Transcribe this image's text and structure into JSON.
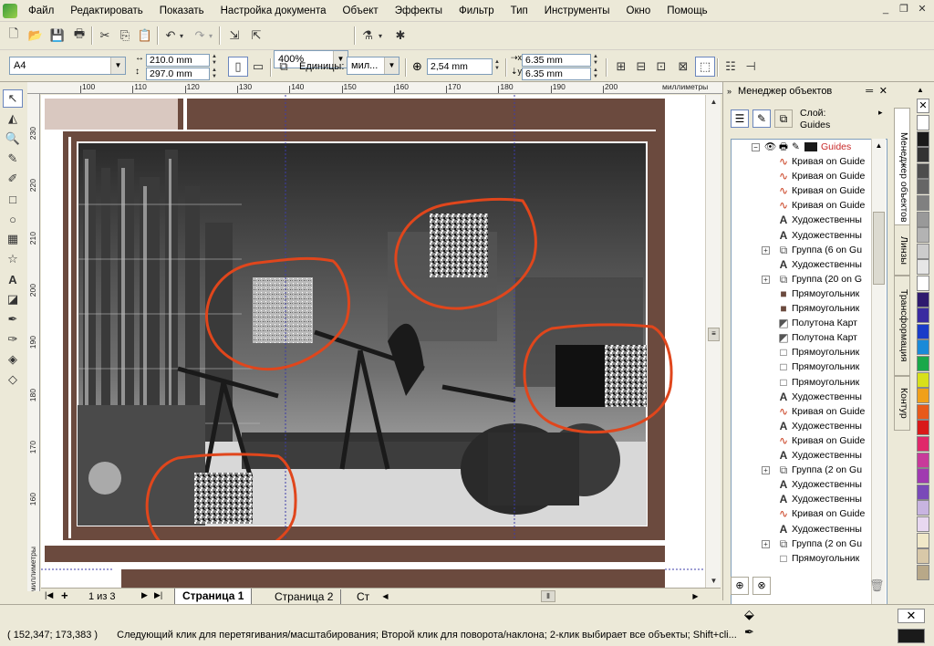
{
  "menubar": {
    "items": [
      "Файл",
      "Редактировать",
      "Показать",
      "Настройка документа",
      "Объект",
      "Эффекты",
      "Фильтр",
      "Тип",
      "Инструменты",
      "Окно",
      "Помощь"
    ]
  },
  "toolbar": {
    "zoom_value": "400%"
  },
  "propbar": {
    "page_size": "A4",
    "width": "210.0 mm",
    "height": "297.0 mm",
    "units_label": "Единицы:",
    "units_value": "мил...",
    "nudge": "2,54 mm",
    "dup_x": "6.35 mm",
    "dup_y": "6.35 mm"
  },
  "rulers": {
    "h_ticks": [
      "100",
      "110",
      "120",
      "130",
      "140",
      "150",
      "160",
      "170",
      "180",
      "190",
      "200"
    ],
    "h_unit": "миллиметры",
    "v_ticks": [
      "230",
      "220",
      "210",
      "200",
      "190",
      "180",
      "170",
      "160"
    ],
    "v_unit": "миллиметры"
  },
  "pages": {
    "counter": "1 из 3",
    "tabs": [
      "Страница 1",
      "Страница 2",
      "Ст"
    ]
  },
  "docker": {
    "title": "Менеджер объектов",
    "layer_label": "Слой:",
    "layer_name": "Guides",
    "root_layer": "Guides",
    "objects": [
      {
        "icon": "curve-icon",
        "label": "Кривая on Guide",
        "expandable": false
      },
      {
        "icon": "curve-icon",
        "label": "Кривая on Guide",
        "expandable": false
      },
      {
        "icon": "curve-icon",
        "label": "Кривая on Guide",
        "expandable": false
      },
      {
        "icon": "curve-icon",
        "label": "Кривая on Guide",
        "expandable": false
      },
      {
        "icon": "artistic-text-icon",
        "label": "Художественны",
        "expandable": false
      },
      {
        "icon": "artistic-text-icon",
        "label": "Художественны",
        "expandable": false
      },
      {
        "icon": "group-icon",
        "label": "Группа (6 on Gu",
        "expandable": true
      },
      {
        "icon": "artistic-text-icon",
        "label": "Художественны",
        "expandable": false
      },
      {
        "icon": "group-icon",
        "label": "Группа (20 on G",
        "expandable": true
      },
      {
        "icon": "rectangle-filled-icon",
        "label": "Прямоугольник",
        "expandable": false
      },
      {
        "icon": "rectangle-filled-icon",
        "label": "Прямоугольник",
        "expandable": false
      },
      {
        "icon": "halftone-icon",
        "label": "Полутона Карт",
        "expandable": false
      },
      {
        "icon": "halftone-icon",
        "label": "Полутона Карт",
        "expandable": false
      },
      {
        "icon": "rectangle-icon",
        "label": "Прямоугольник",
        "expandable": false
      },
      {
        "icon": "rectangle-icon",
        "label": "Прямоугольник",
        "expandable": false
      },
      {
        "icon": "rectangle-icon",
        "label": "Прямоугольник",
        "expandable": false
      },
      {
        "icon": "artistic-text-icon",
        "label": "Художественны",
        "expandable": false
      },
      {
        "icon": "curve-icon",
        "label": "Кривая on Guide",
        "expandable": false
      },
      {
        "icon": "artistic-text-icon",
        "label": "Художественны",
        "expandable": false
      },
      {
        "icon": "curve-icon",
        "label": "Кривая on Guide",
        "expandable": false
      },
      {
        "icon": "artistic-text-icon",
        "label": "Художественны",
        "expandable": false
      },
      {
        "icon": "group-icon",
        "label": "Группа (2 on Gu",
        "expandable": true
      },
      {
        "icon": "artistic-text-icon",
        "label": "Художественны",
        "expandable": false
      },
      {
        "icon": "artistic-text-icon",
        "label": "Художественны",
        "expandable": false
      },
      {
        "icon": "curve-icon",
        "label": "Кривая on Guide",
        "expandable": false
      },
      {
        "icon": "artistic-text-icon",
        "label": "Художественны",
        "expandable": false
      },
      {
        "icon": "group-icon",
        "label": "Группа (2 on Gu",
        "expandable": true
      },
      {
        "icon": "rectangle-icon",
        "label": "Прямоугольник",
        "expandable": false
      }
    ]
  },
  "vtabs": [
    "Менеджер объектов",
    "Линзы",
    "Трансформация",
    "Контур"
  ],
  "palette": [
    "#ffffff",
    "#1a1a1a",
    "#333333",
    "#4d4d4d",
    "#666666",
    "#808080",
    "#999999",
    "#b3b3b3",
    "#cccccc",
    "#e6e6e6",
    "#ffffff",
    "#2e1a6e",
    "#3a2ba0",
    "#1a3cc8",
    "#1a8ad8",
    "#1aa84a",
    "#d8e01a",
    "#f0a01a",
    "#e85a1a",
    "#d81a1a",
    "#e0286a",
    "#c83a9a",
    "#a03ab0",
    "#7a4ab8",
    "#c8b4e0",
    "#e8d8f0",
    "#f0e8c8",
    "#d8c8a8",
    "#b8a888"
  ],
  "status": {
    "coords": "( 152,347; 173,383 )",
    "message": "Следующий клик для перетягивания/масштабирования; Второй клик для поворота/наклона; 2-клик выбирает все объекты; Shift+cli..."
  },
  "colors": {
    "brown_frame": "#6b4a3e",
    "annotation_red": "#e0461c"
  }
}
